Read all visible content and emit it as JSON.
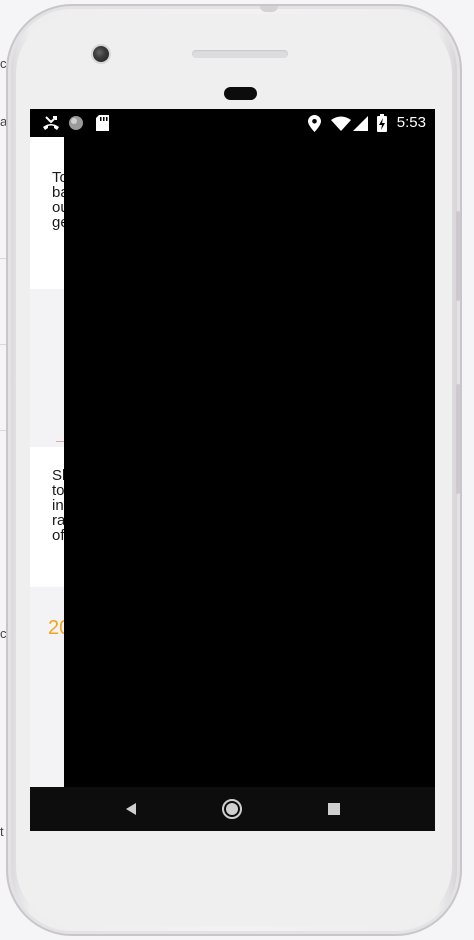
{
  "host": {
    "fragments": [
      "c",
      "a",
      "c",
      "t"
    ]
  },
  "status_bar": {
    "time": "5:53",
    "icons": [
      "missed-call-icon",
      "circle-notification-icon",
      "sd-card-icon",
      "location-icon",
      "wifi-icon",
      "signal-icon",
      "battery-charging-icon"
    ]
  },
  "app": {
    "paragraph_1": [
      "To",
      "ba",
      "ou",
      "ge"
    ],
    "paragraph_2": [
      "Sl",
      "to",
      "in",
      "ra",
      "of"
    ],
    "year_fragment": "20"
  },
  "nav": {
    "buttons": [
      "back-icon",
      "home-icon",
      "recents-icon"
    ]
  },
  "colors": {
    "accent": "#f5a31a",
    "screen_overlay": "#000000",
    "phone_body": "#f2f2f3"
  }
}
